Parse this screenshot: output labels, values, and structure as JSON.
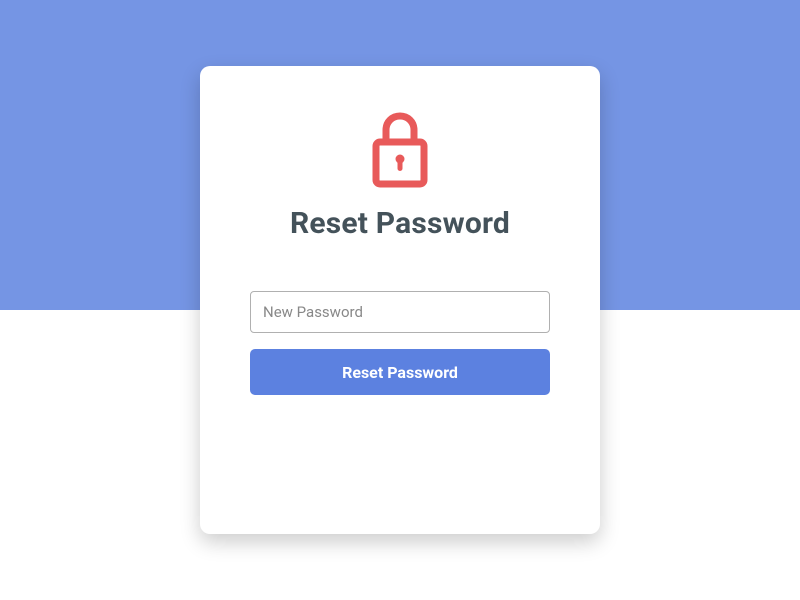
{
  "card": {
    "title": "Reset Password",
    "form": {
      "password_placeholder": "New Password",
      "submit_label": "Reset Password"
    }
  }
}
